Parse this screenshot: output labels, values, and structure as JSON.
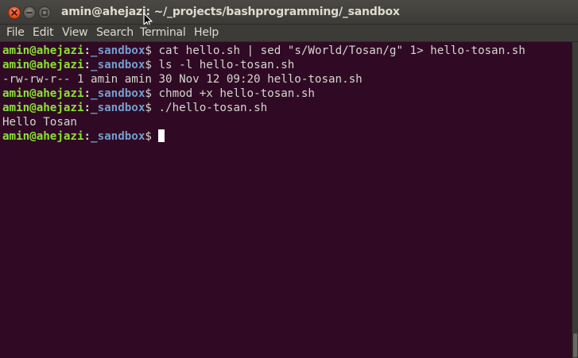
{
  "window": {
    "title": "amin@ahejazi: ~/_projects/bashprogramming/_sandbox"
  },
  "menu": {
    "items": [
      "File",
      "Edit",
      "View",
      "Search",
      "Terminal",
      "Help"
    ]
  },
  "terminal": {
    "lines": [
      {
        "type": "prompt",
        "user": "amin@ahejazi",
        "sep": ":",
        "path": "_sandbox",
        "symbol": "$ ",
        "command": "cat hello.sh | sed \"s/World/Tosan/g\" 1> hello-tosan.sh"
      },
      {
        "type": "prompt",
        "user": "amin@ahejazi",
        "sep": ":",
        "path": "_sandbox",
        "symbol": "$ ",
        "command": "ls -l hello-tosan.sh"
      },
      {
        "type": "output",
        "text": "-rw-rw-r-- 1 amin amin 30 Nov 12 09:20 hello-tosan.sh"
      },
      {
        "type": "prompt",
        "user": "amin@ahejazi",
        "sep": ":",
        "path": "_sandbox",
        "symbol": "$ ",
        "command": "chmod +x hello-tosan.sh"
      },
      {
        "type": "prompt",
        "user": "amin@ahejazi",
        "sep": ":",
        "path": "_sandbox",
        "symbol": "$ ",
        "command": "./hello-tosan.sh"
      },
      {
        "type": "output",
        "text": "Hello Tosan"
      },
      {
        "type": "prompt",
        "user": "amin@ahejazi",
        "sep": ":",
        "path": "_sandbox",
        "symbol": "$ ",
        "command": ""
      }
    ]
  },
  "colors": {
    "terminal_background": "#300a24",
    "prompt_user": "#8ae234",
    "prompt_path": "#729fcf",
    "text": "#d3d7cf",
    "titlebar": "#3c3b37",
    "close_button": "#e95420"
  },
  "icons": {
    "close": "close-icon",
    "minimize": "minimize-icon",
    "maximize": "maximize-icon",
    "pointer": "mouse-pointer-icon"
  }
}
